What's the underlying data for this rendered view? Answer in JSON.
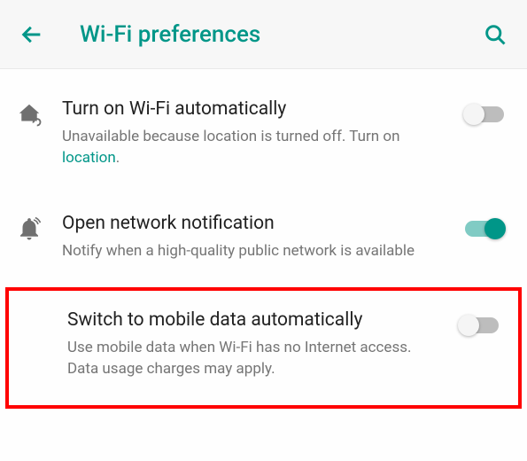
{
  "header": {
    "title": "Wi-Fi preferences"
  },
  "settings": {
    "auto_wifi": {
      "title": "Turn on Wi-Fi automatically",
      "subtitle_prefix": "Unavailable because location is turned off. Turn on ",
      "subtitle_link": "location",
      "subtitle_suffix": ".",
      "toggle": "off"
    },
    "open_network": {
      "title": "Open network notification",
      "subtitle": "Notify when a high-quality public network is available",
      "toggle": "on"
    },
    "mobile_data": {
      "title": "Switch to mobile data automatically",
      "subtitle": "Use mobile data when Wi-Fi has no Internet access. Data usage charges may apply.",
      "toggle": "off"
    }
  }
}
